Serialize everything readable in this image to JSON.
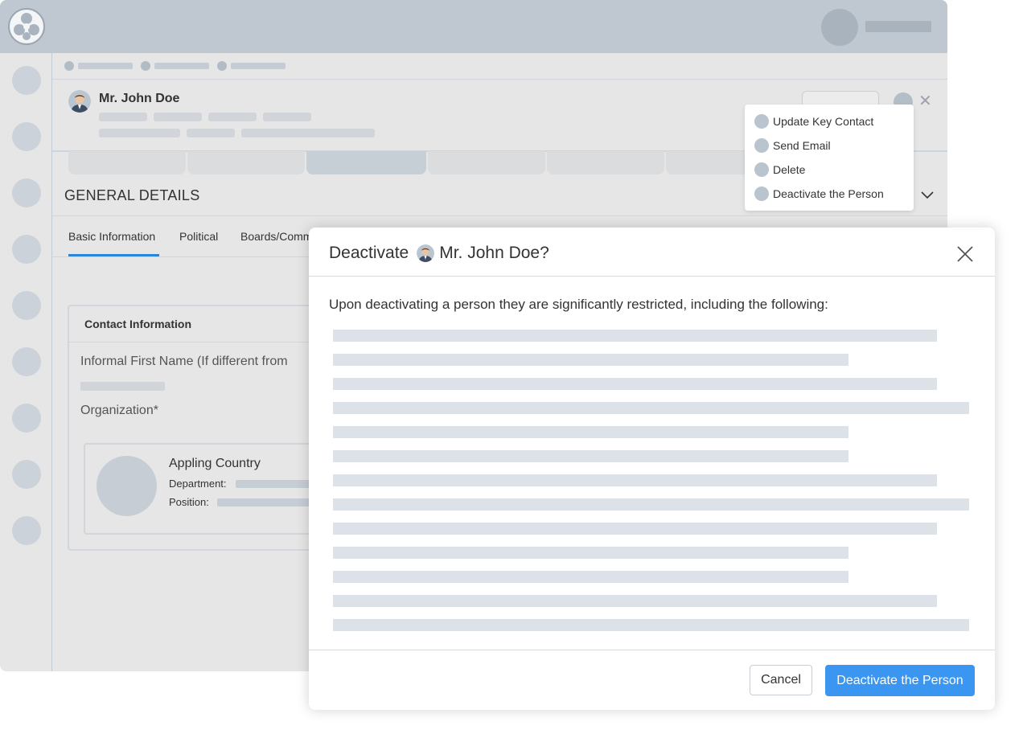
{
  "profile": {
    "name": "Mr. John Doe"
  },
  "section": {
    "title": "GENERAL DETAILS"
  },
  "subtabs": [
    {
      "label": "Basic Information",
      "active": true
    },
    {
      "label": "Political",
      "active": false
    },
    {
      "label": "Boards/Comm",
      "active": false
    }
  ],
  "contact_card": {
    "title": "Contact Information",
    "field1_label": "Informal First Name (If different from",
    "field2_label": "Organization*",
    "org_name": "Appling Country",
    "department_label": "Department:",
    "position_label": "Position:"
  },
  "dropdown": {
    "items": [
      {
        "label": "Update Key Contact"
      },
      {
        "label": "Send Email"
      },
      {
        "label": "Delete"
      },
      {
        "label": "Deactivate the Person"
      }
    ]
  },
  "modal": {
    "title_prefix": "Deactivate",
    "title_name": "Mr. John Doe?",
    "description": "Upon deactivating a person they are significantly restricted, including the following:",
    "cancel_label": "Cancel",
    "confirm_label": "Deactivate the Person"
  },
  "icons": {
    "logo": "app-logo-icon",
    "more": "more-options-icon",
    "close": "close-icon",
    "chevron": "chevron-down-icon"
  },
  "colors": {
    "topbar": "#bfc8d1",
    "accent": "#3b96f1",
    "active_tab_underline": "#2b86d9",
    "placeholder": "#dde2e8"
  }
}
